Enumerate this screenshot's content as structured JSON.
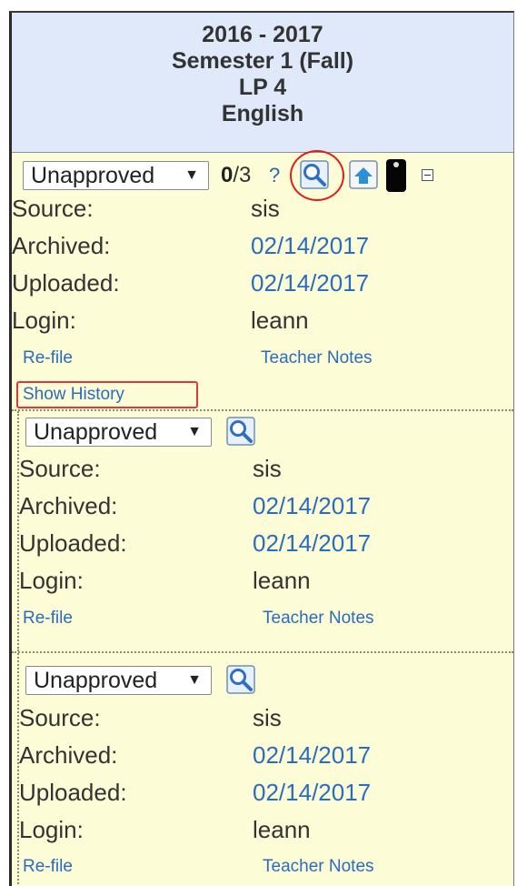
{
  "header": {
    "year": "2016 - 2017",
    "semester": "Semester 1 (Fall)",
    "period": "LP 4",
    "subject": "English"
  },
  "records": [
    {
      "status": "Unapproved",
      "count_bold": "0",
      "count_rest": "/3",
      "help": "?",
      "source_label": "Source:",
      "source": "sis",
      "archived_label": "Archived:",
      "archived": "02/14/2017",
      "uploaded_label": "Uploaded:",
      "uploaded": "02/14/2017",
      "login_label": "Login:",
      "login": "leann",
      "refile": "Re-file",
      "notes": "Teacher Notes",
      "history": "Show History"
    },
    {
      "status": "Unapproved",
      "source_label": "Source:",
      "source": "sis",
      "archived_label": "Archived:",
      "archived": "02/14/2017",
      "uploaded_label": "Uploaded:",
      "uploaded": "02/14/2017",
      "login_label": "Login:",
      "login": "leann",
      "refile": "Re-file",
      "notes": "Teacher Notes"
    },
    {
      "status": "Unapproved",
      "source_label": "Source:",
      "source": "sis",
      "archived_label": "Archived:",
      "archived": "02/14/2017",
      "uploaded_label": "Uploaded:",
      "uploaded": "02/14/2017",
      "login_label": "Login:",
      "login": "leann",
      "refile": "Re-file",
      "notes": "Teacher Notes"
    }
  ],
  "icons": {
    "view": "magnifier-icon",
    "upload": "upload-icon",
    "phone": "phone-icon",
    "collapse": "collapse-icon"
  },
  "colors": {
    "header_bg": "#dfe9f9",
    "record_bg": "#fcfcd6",
    "link": "#2a6cbd",
    "annotation": "#e11c1c"
  }
}
